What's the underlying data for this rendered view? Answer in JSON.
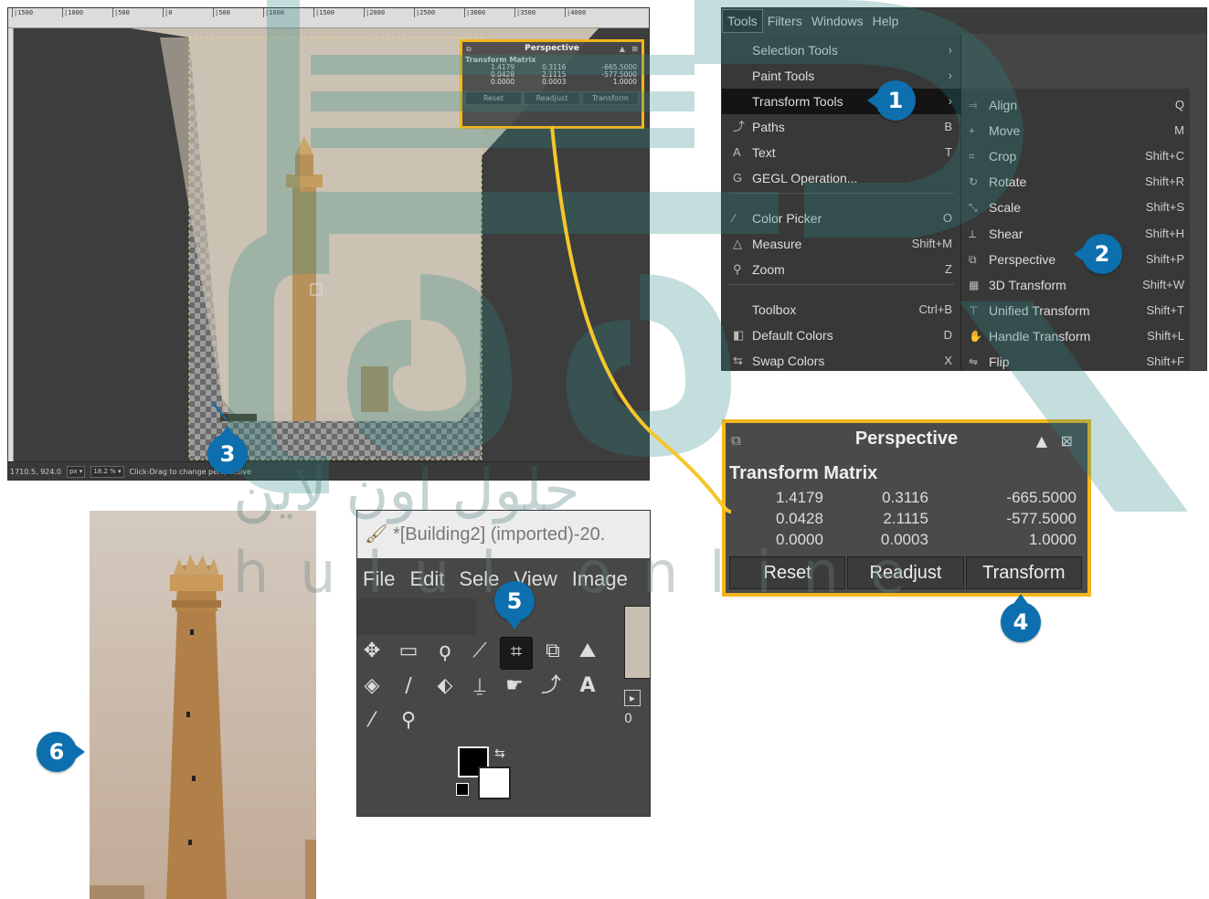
{
  "canvas": {
    "ruler_ticks": [
      "|1500",
      "|1000",
      "|500",
      "|0",
      "|500",
      "|1000",
      "|1500",
      "|2000",
      "|2500",
      "|3000",
      "|3500",
      "|4000"
    ],
    "status": {
      "coords": "1710.5, 924.0",
      "unit": "px",
      "zoom": "18.2 %",
      "message": "Click-Drag to change perspective"
    }
  },
  "small_dialog": {
    "title": "Perspective",
    "subtitle": "Transform Matrix",
    "matrix": [
      [
        "1.4179",
        "0.3116",
        "-665.5000"
      ],
      [
        "0.0428",
        "2.1115",
        "-577.5000"
      ],
      [
        "0.0000",
        "0.0003",
        "1.0000"
      ]
    ],
    "buttons": [
      "Reset",
      "Readjust",
      "Transform"
    ]
  },
  "menubar": [
    "Tools",
    "Filters",
    "Windows",
    "Help"
  ],
  "tools_menu": [
    {
      "icon": "",
      "label": "Selection Tools",
      "shortcut": "",
      "submenu": true
    },
    {
      "icon": "",
      "label": "Paint Tools",
      "shortcut": "",
      "submenu": true
    },
    {
      "icon": "",
      "label": "Transform Tools",
      "shortcut": "",
      "submenu": true,
      "highlighted": true
    },
    {
      "icon": "paths-icon",
      "label": "Paths",
      "shortcut": "B"
    },
    {
      "icon": "text-icon",
      "label": "Text",
      "shortcut": "T"
    },
    {
      "icon": "gegl-icon",
      "label": "GEGL Operation...",
      "shortcut": ""
    },
    {
      "icon": "color-picker-icon",
      "label": "Color Picker",
      "shortcut": "O"
    },
    {
      "icon": "measure-icon",
      "label": "Measure",
      "shortcut": "Shift+M"
    },
    {
      "icon": "zoom-icon",
      "label": "Zoom",
      "shortcut": "Z"
    },
    {
      "icon": "",
      "label": "Toolbox",
      "shortcut": "Ctrl+B"
    },
    {
      "icon": "default-colors-icon",
      "label": "Default Colors",
      "shortcut": "D"
    },
    {
      "icon": "swap-colors-icon",
      "label": "Swap Colors",
      "shortcut": "X"
    }
  ],
  "transform_submenu": [
    {
      "icon": "align-icon",
      "label": "Align",
      "shortcut": "Q"
    },
    {
      "icon": "move-icon",
      "label": "Move",
      "shortcut": "M"
    },
    {
      "icon": "crop-icon",
      "label": "Crop",
      "shortcut": "Shift+C"
    },
    {
      "icon": "rotate-icon",
      "label": "Rotate",
      "shortcut": "Shift+R"
    },
    {
      "icon": "scale-icon",
      "label": "Scale",
      "shortcut": "Shift+S"
    },
    {
      "icon": "shear-icon",
      "label": "Shear",
      "shortcut": "Shift+H"
    },
    {
      "icon": "perspective-icon",
      "label": "Perspective",
      "shortcut": "Shift+P"
    },
    {
      "icon": "3d-transform-icon",
      "label": "3D Transform",
      "shortcut": "Shift+W"
    },
    {
      "icon": "unified-transform-icon",
      "label": "Unified Transform",
      "shortcut": "Shift+T"
    },
    {
      "icon": "handle-transform-icon",
      "label": "Handle Transform",
      "shortcut": "Shift+L"
    },
    {
      "icon": "flip-icon",
      "label": "Flip",
      "shortcut": "Shift+F"
    }
  ],
  "big_dialog": {
    "title": "Perspective",
    "subtitle": "Transform Matrix",
    "matrix": [
      [
        "1.4179",
        "0.3116",
        "-665.5000"
      ],
      [
        "0.0428",
        "2.1115",
        "-577.5000"
      ],
      [
        "0.0000",
        "0.0003",
        "1.0000"
      ]
    ],
    "buttons": [
      "Reset",
      "Readjust",
      "Transform"
    ]
  },
  "gimp_window": {
    "title": "*[Building2] (imported)-20.",
    "menu": [
      "File",
      "Edit",
      "Sele",
      "View",
      "Image"
    ],
    "ruler_label": "0"
  },
  "badges": [
    "1",
    "2",
    "3",
    "4",
    "5",
    "6"
  ],
  "watermark": {
    "arabic": "حلول اون لاين",
    "latin": "hulul online"
  },
  "colors": {
    "highlight": "#f4b61a",
    "badge": "#0d6fad",
    "gimp_bg": "#454545",
    "menu_bg": "#383838"
  }
}
